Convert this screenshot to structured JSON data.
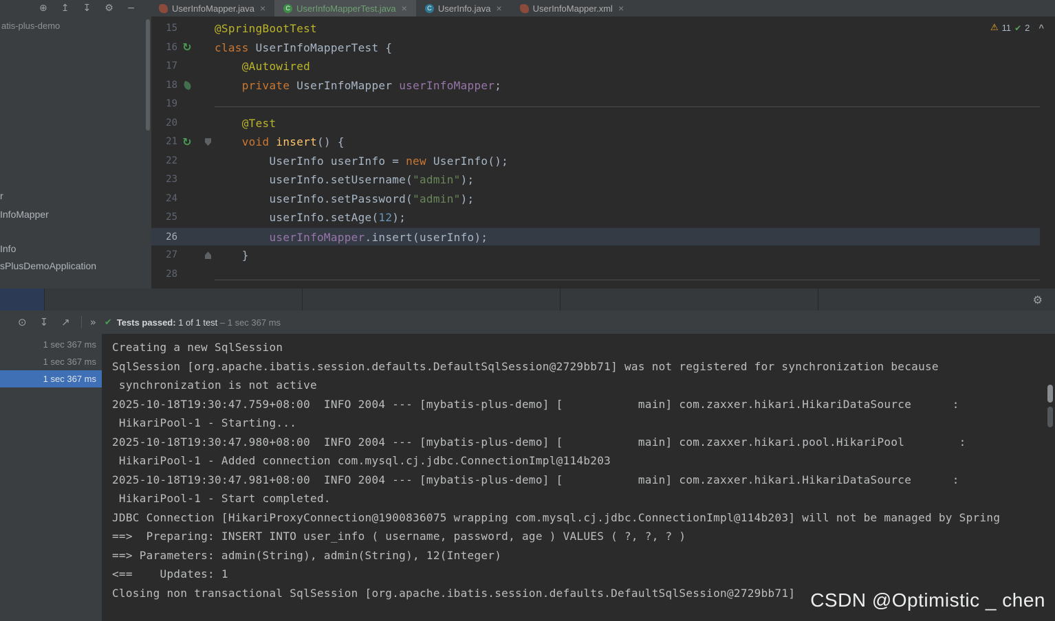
{
  "colors": {
    "test_passed_green": "#499c54",
    "warning_yellow": "#f0a732",
    "selection_blue": "#3f70b5",
    "active_tab_text_green": "#6ea171"
  },
  "topbar": {
    "tool_icons": [
      {
        "name": "locate-icon",
        "glyph": "⊕"
      },
      {
        "name": "expand-all-icon",
        "glyph": "↥"
      },
      {
        "name": "collapse-all-icon",
        "glyph": "↧"
      },
      {
        "name": "settings-gear-icon",
        "glyph": "⚙"
      },
      {
        "name": "hide-panel-icon",
        "glyph": "−"
      }
    ],
    "tabs": [
      {
        "label": "UserInfoMapper.java",
        "icon": "mapper",
        "active": false,
        "close": "×"
      },
      {
        "label": "UserInfoMapperTest.java",
        "icon": "test-class",
        "active": true,
        "close": "×"
      },
      {
        "label": "UserInfo.java",
        "icon": "class",
        "active": false,
        "close": "×"
      },
      {
        "label": "UserInfoMapper.xml",
        "icon": "xml-mapper",
        "active": false,
        "close": "×"
      }
    ]
  },
  "project_panel": {
    "root_label": "atis-plus-demo",
    "items": [
      "r",
      "InfoMapper",
      "Info",
      "sPlusDemoApplication"
    ]
  },
  "editor": {
    "inspections": {
      "warnings": "11",
      "passed": "2",
      "collapse_glyph": "^"
    },
    "lines": [
      {
        "n": "15",
        "tokens": [
          [
            "ann",
            "@SpringBootTest"
          ]
        ]
      },
      {
        "n": "16",
        "gutter": "run",
        "tokens": [
          [
            "kw",
            "class "
          ],
          [
            "plain",
            "UserInfoMapperTest {"
          ]
        ]
      },
      {
        "n": "17",
        "tokens": [
          [
            "plain",
            "    "
          ],
          [
            "ann",
            "@Autowired"
          ]
        ]
      },
      {
        "n": "18",
        "gutter": "bean",
        "tokens": [
          [
            "plain",
            "    "
          ],
          [
            "kw",
            "private "
          ],
          [
            "plain",
            "UserInfoMapper "
          ],
          [
            "field",
            "userInfoMapper"
          ],
          [
            "plain",
            ";"
          ]
        ]
      },
      {
        "n": "19",
        "tokens": []
      },
      {
        "n": "20",
        "tokens": [
          [
            "plain",
            "    "
          ],
          [
            "ann",
            "@Test"
          ]
        ]
      },
      {
        "n": "21",
        "gutter": "run",
        "marker": "down",
        "tokens": [
          [
            "plain",
            "    "
          ],
          [
            "kw",
            "void "
          ],
          [
            "meth",
            "insert"
          ],
          [
            "plain",
            "() {"
          ]
        ]
      },
      {
        "n": "22",
        "tokens": [
          [
            "plain",
            "        UserInfo userInfo = "
          ],
          [
            "kw",
            "new "
          ],
          [
            "plain",
            "UserInfo();"
          ]
        ]
      },
      {
        "n": "23",
        "tokens": [
          [
            "plain",
            "        userInfo.setUsername("
          ],
          [
            "str",
            "\"admin\""
          ],
          [
            "plain",
            ");"
          ]
        ]
      },
      {
        "n": "24",
        "tokens": [
          [
            "plain",
            "        userInfo.setPassword("
          ],
          [
            "str",
            "\"admin\""
          ],
          [
            "plain",
            ");"
          ]
        ]
      },
      {
        "n": "25",
        "tokens": [
          [
            "plain",
            "        userInfo.setAge("
          ],
          [
            "num",
            "12"
          ],
          [
            "plain",
            ");"
          ]
        ]
      },
      {
        "n": "26",
        "current": true,
        "tokens": [
          [
            "plain",
            "        "
          ],
          [
            "field",
            "userInfoMapper"
          ],
          [
            "plain",
            ".insert(userInfo);"
          ]
        ]
      },
      {
        "n": "27",
        "marker": "up",
        "tokens": [
          [
            "plain",
            "    }"
          ]
        ]
      },
      {
        "n": "28",
        "tokens": []
      }
    ]
  },
  "run_panel": {
    "toolbar_icons": [
      {
        "name": "filter-passed-icon",
        "glyph": "⊙"
      },
      {
        "name": "import-results-icon",
        "glyph": "↧"
      },
      {
        "name": "export-results-icon",
        "glyph": "↗"
      }
    ],
    "more_glyph": "»",
    "options_gear_glyph": "⚙",
    "status": {
      "check_glyph": "✔",
      "label": "Tests passed:",
      "detail": " 1 of 1 test",
      "time": " – 1 sec 367 ms"
    },
    "tree_rows": [
      {
        "time": "1 sec 367 ms",
        "selected": false
      },
      {
        "time": "1 sec 367 ms",
        "selected": false
      },
      {
        "time": "1 sec 367 ms",
        "selected": true
      }
    ],
    "console_lines": [
      "Creating a new SqlSession",
      "SqlSession [org.apache.ibatis.session.defaults.DefaultSqlSession@2729bb71] was not registered for synchronization because",
      " synchronization is not active",
      "2025-10-18T19:30:47.759+08:00  INFO 2004 --- [mybatis-plus-demo] [           main] com.zaxxer.hikari.HikariDataSource      :",
      " HikariPool-1 - Starting...",
      "2025-10-18T19:30:47.980+08:00  INFO 2004 --- [mybatis-plus-demo] [           main] com.zaxxer.hikari.pool.HikariPool        :",
      " HikariPool-1 - Added connection com.mysql.cj.jdbc.ConnectionImpl@114b203",
      "2025-10-18T19:30:47.981+08:00  INFO 2004 --- [mybatis-plus-demo] [           main] com.zaxxer.hikari.HikariDataSource      :",
      " HikariPool-1 - Start completed.",
      "JDBC Connection [HikariProxyConnection@1900836075 wrapping com.mysql.cj.jdbc.ConnectionImpl@114b203] will not be managed by Spring",
      "==>  Preparing: INSERT INTO user_info ( username, password, age ) VALUES ( ?, ?, ? )",
      "==> Parameters: admin(String), admin(String), 12(Integer)",
      "<==    Updates: 1",
      "Closing non transactional SqlSession [org.apache.ibatis.session.defaults.DefaultSqlSession@2729bb71]"
    ]
  },
  "watermark": "CSDN @Optimistic _ chen"
}
